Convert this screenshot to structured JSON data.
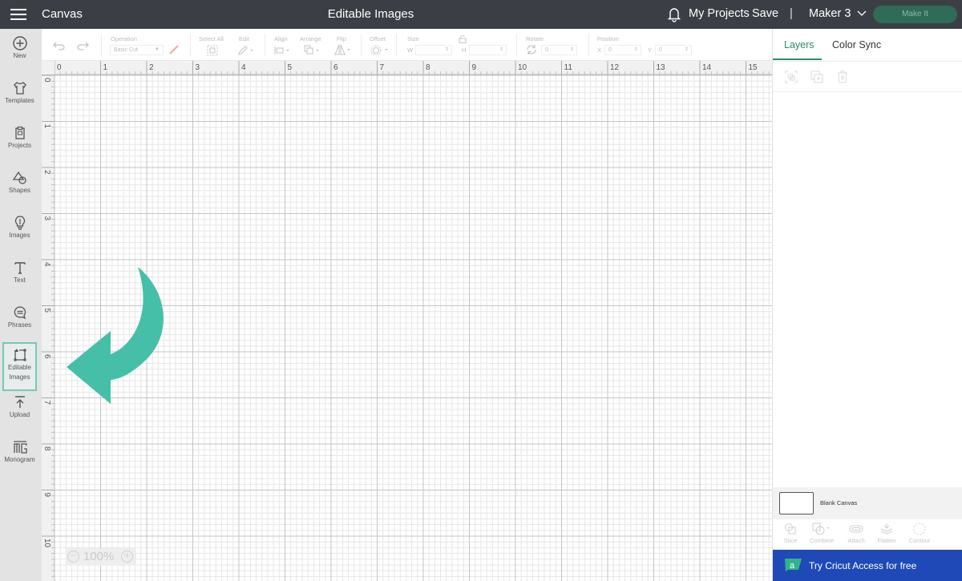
{
  "topbar": {
    "menu_icon": "hamburger-icon",
    "app_title": "Canvas",
    "document_title": "Editable Images",
    "notification_icon": "bell-icon",
    "my_projects": "My Projects",
    "save": "Save",
    "separator": "|",
    "machine": "Maker 3",
    "machine_chevron": "chevron-down-icon",
    "make_it": "Make It"
  },
  "sidebar": {
    "items": [
      {
        "label": "New",
        "icon": "plus-circle-icon"
      },
      {
        "label": "Templates",
        "icon": "tshirt-icon"
      },
      {
        "label": "Projects",
        "icon": "clipboard-icon"
      },
      {
        "label": "Shapes",
        "icon": "shapes-icon"
      },
      {
        "label": "Images",
        "icon": "lightbulb-icon"
      },
      {
        "label": "Text",
        "icon": "text-icon"
      },
      {
        "label": "Phrases",
        "icon": "speech-bubble-icon"
      },
      {
        "label": "Editable",
        "label2": "Images",
        "icon": "editable-images-icon",
        "active": true
      },
      {
        "label": "Upload",
        "icon": "upload-icon"
      },
      {
        "label": "Monogram",
        "icon": "monogram-icon"
      }
    ]
  },
  "toolbar": {
    "undo_icon": "undo-icon",
    "redo_icon": "redo-icon",
    "operation_label": "Operation",
    "operation_value": "Basic Cut",
    "select_all_label": "Select All",
    "edit_label": "Edit",
    "align_label": "Align",
    "arrange_label": "Arrange",
    "flip_label": "Flip",
    "offset_label": "Offset",
    "size_label": "Size",
    "w_label": "W",
    "h_label": "H",
    "rotate_label": "Rotate",
    "rotate_value": "0",
    "position_label": "Position",
    "x_label": "X",
    "x_value": "0",
    "y_label": "Y",
    "y_value": "0"
  },
  "canvas": {
    "ruler_x": [
      "0",
      "1",
      "2",
      "3",
      "4",
      "5",
      "6",
      "7",
      "8",
      "9",
      "10",
      "11",
      "12",
      "13",
      "14",
      "15"
    ],
    "ruler_y": [
      "0",
      "1",
      "2",
      "3",
      "4",
      "5",
      "6",
      "7",
      "8",
      "9",
      "10"
    ],
    "arrow_color": "#46bfa9",
    "zoom_level": "100%",
    "zoom_out": "−",
    "zoom_in": "+"
  },
  "right_panel": {
    "tabs": [
      {
        "label": "Layers",
        "active": true
      },
      {
        "label": "Color Sync",
        "active": false
      }
    ],
    "layer_tools": [
      "group-icon",
      "duplicate-icon",
      "delete-icon"
    ],
    "blank_canvas": "Blank Canvas",
    "bottom_tools": [
      {
        "label": "Slice",
        "icon": "slice-icon"
      },
      {
        "label": "Combine",
        "icon": "combine-icon"
      },
      {
        "label": "Attach",
        "icon": "attach-icon"
      },
      {
        "label": "Flatten",
        "icon": "flatten-icon"
      },
      {
        "label": "Contour",
        "icon": "contour-icon"
      }
    ],
    "access_banner": "Try Cricut Access for free",
    "access_logo_letter": "a"
  },
  "colors": {
    "topbar": "#3b3f45",
    "accent": "#2d8a6e",
    "banner": "#1f49b6",
    "arrow": "#46bfa9"
  }
}
